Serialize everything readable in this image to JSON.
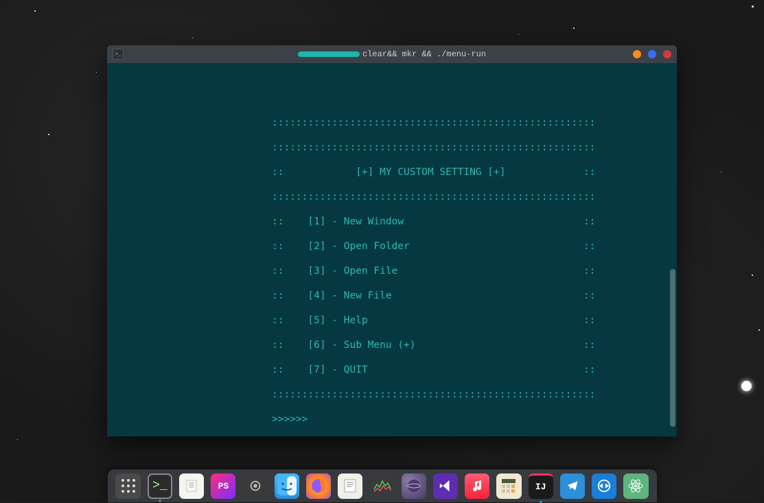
{
  "window": {
    "title_suffix": "clear&& mkr && ./menu-run"
  },
  "menu": {
    "border": "::::::::::::::::::::::::::::::::::::::::::::::::::::::",
    "header_line": "::            [+] MY CUSTOM SETTING [+]             ::",
    "items": [
      "::    [1] - New Window                              ::",
      "::    [2] - Open Folder                             ::",
      "::    [3] - Open File                               ::",
      "::    [4] - New File                                ::",
      "::    [5] - Help                                    ::",
      "::    [6] - Sub Menu (+)                            ::",
      "::    [7] - QUIT                                    ::"
    ],
    "prompt": ">>>>>>"
  },
  "dock": {
    "apps_name": "show-applications",
    "items": [
      {
        "name": "terminal",
        "running": true
      },
      {
        "name": "notes",
        "running": false
      },
      {
        "name": "toolbox",
        "running": false
      },
      {
        "name": "settings",
        "running": false
      },
      {
        "name": "finder",
        "running": false
      },
      {
        "name": "firefox",
        "running": false
      },
      {
        "name": "text-editor",
        "running": false
      },
      {
        "name": "system-monitor",
        "running": false
      },
      {
        "name": "eclipse",
        "running": false
      },
      {
        "name": "vscode",
        "running": false
      },
      {
        "name": "music",
        "running": false
      },
      {
        "name": "calculator",
        "running": false
      },
      {
        "name": "intellij",
        "running": true
      },
      {
        "name": "telegram",
        "running": false
      },
      {
        "name": "teamviewer",
        "running": false
      },
      {
        "name": "atom",
        "running": false
      }
    ]
  }
}
